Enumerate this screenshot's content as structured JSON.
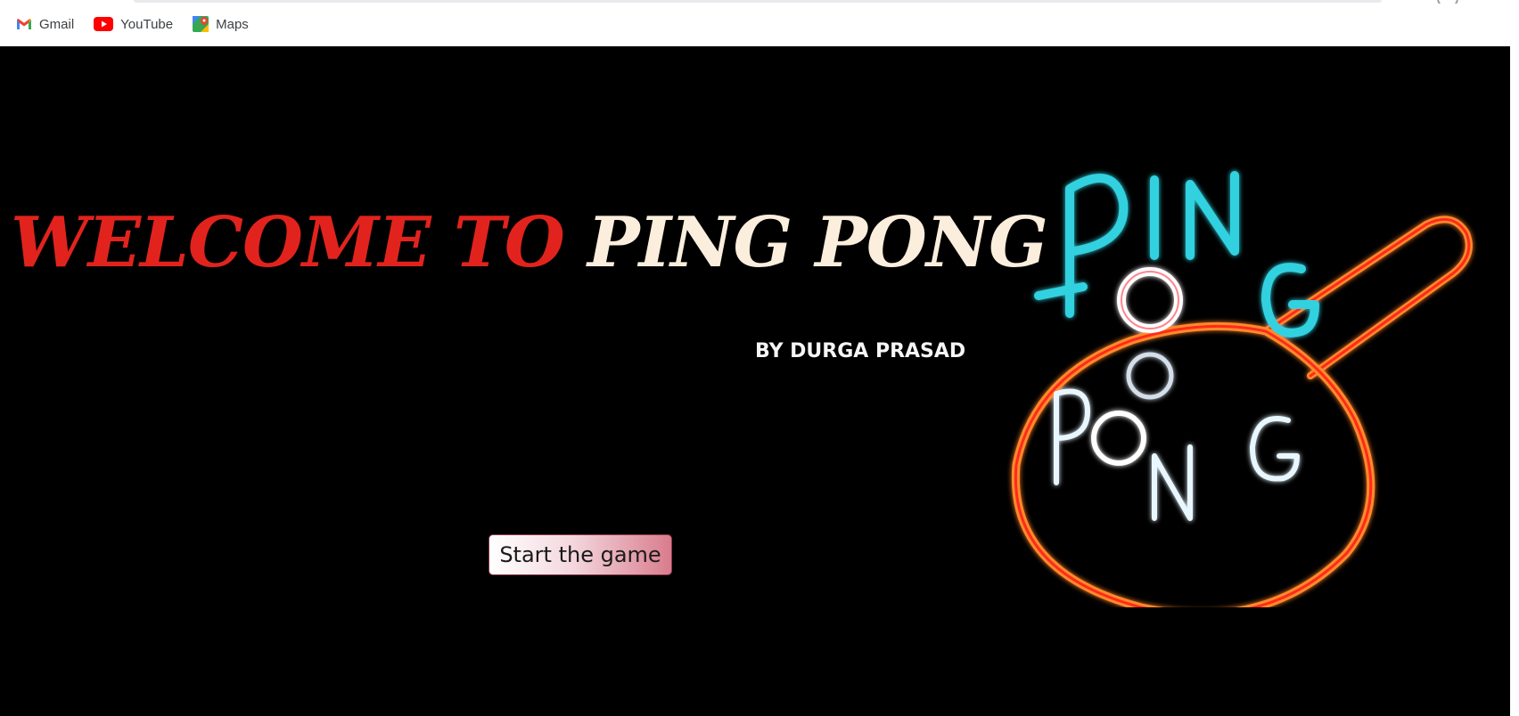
{
  "bookmarks": [
    {
      "label": "Gmail",
      "icon": "gmail-icon"
    },
    {
      "label": "YouTube",
      "icon": "youtube-icon"
    },
    {
      "label": "Maps",
      "icon": "maps-icon"
    }
  ],
  "page": {
    "headline_part1": "WELCOME TO",
    "headline_part2": "PING PONG",
    "byline": "BY DURGA PRASAD",
    "start_button": "Start the game"
  },
  "logo": {
    "word_top": "PING",
    "word_bottom": "PONG"
  },
  "colors": {
    "background": "#000000",
    "headline_red": "#e2231d",
    "headline_cream": "#fbeedd",
    "neon_cyan": "#33d1e0",
    "neon_orange": "#ff7a1a",
    "neon_red": "#ff2a1a"
  }
}
